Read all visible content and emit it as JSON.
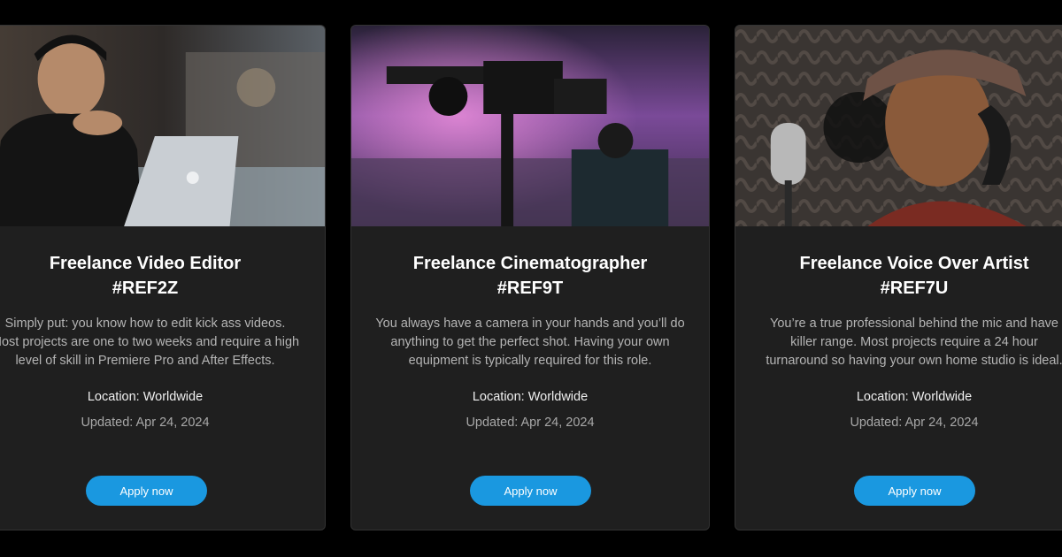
{
  "cards": [
    {
      "title": "Freelance Video Editor",
      "code": "#REF2Z",
      "description": "Simply put: you know how to edit kick ass videos. Most projects are one to two weeks and require a high level of skill in Premiere Pro and After Effects.",
      "location": "Location: Worldwide",
      "updated": "Updated: Apr 24, 2024",
      "apply_label": "Apply now"
    },
    {
      "title": "Freelance Cinematographer",
      "code": "#REF9T",
      "description": "You always have a camera in your hands and you’ll do anything to get the perfect shot. Having your own equipment is typically required for this role.",
      "location": "Location: Worldwide",
      "updated": "Updated: Apr 24, 2024",
      "apply_label": "Apply now"
    },
    {
      "title": "Freelance Voice Over Artist",
      "code": "#REF7U",
      "description": "You’re a true professional behind the mic and have killer range. Most projects require a 24 hour turnaround so having your own home studio is ideal.",
      "location": "Location: Worldwide",
      "updated": "Updated: Apr 24, 2024",
      "apply_label": "Apply now"
    }
  ],
  "colors": {
    "background": "#000000",
    "card": "#1f1f1f",
    "accent": "#1a98e0"
  }
}
